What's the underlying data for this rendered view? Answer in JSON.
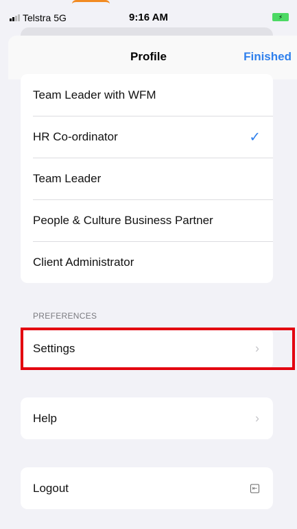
{
  "status_bar": {
    "carrier": "Telstra",
    "network": "5G",
    "time": "9:16 AM"
  },
  "nav": {
    "title": "Profile",
    "done_label": "Finished"
  },
  "roles": {
    "items": [
      {
        "label": "Team Leader with WFM",
        "selected": false
      },
      {
        "label": "HR Co-ordinator",
        "selected": true
      },
      {
        "label": "Team Leader",
        "selected": false
      },
      {
        "label": "People & Culture Business Partner",
        "selected": false
      },
      {
        "label": "Client Administrator",
        "selected": false
      }
    ],
    "check_glyph": "✓"
  },
  "preferences": {
    "header": "PREFERENCES",
    "settings_label": "Settings"
  },
  "help": {
    "label": "Help"
  },
  "logout": {
    "label": "Logout"
  },
  "icons": {
    "chevron": "›",
    "logout_icon": "⇤"
  },
  "colors": {
    "accent": "#2f80ed",
    "highlight": "#e3000f",
    "background": "#f2f2f7"
  }
}
